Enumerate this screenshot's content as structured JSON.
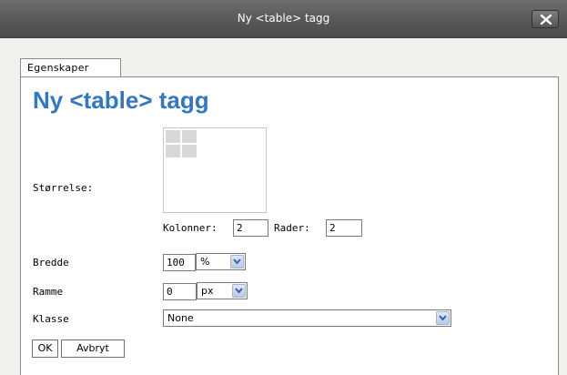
{
  "window": {
    "title": "Ny <table> tagg",
    "close_icon": "close-icon"
  },
  "tabs": [
    {
      "label": "Egenskaper",
      "active": true
    }
  ],
  "dialog": {
    "heading": "Ny <table> tagg",
    "heading_color": "#3277c4"
  },
  "size": {
    "label": "Størrelse:",
    "grid_preview": {
      "columns": 2,
      "rows": 2
    },
    "columns_label": "Kolonner:",
    "columns_value": "2",
    "rows_label": "Rader:",
    "rows_value": "2"
  },
  "width": {
    "label": "Bredde",
    "value": "100",
    "unit": "%"
  },
  "border": {
    "label": "Ramme",
    "value": "0",
    "unit": "px"
  },
  "class": {
    "label": "Klasse",
    "value": "None"
  },
  "buttons": {
    "ok": "OK",
    "cancel": "Avbryt"
  }
}
